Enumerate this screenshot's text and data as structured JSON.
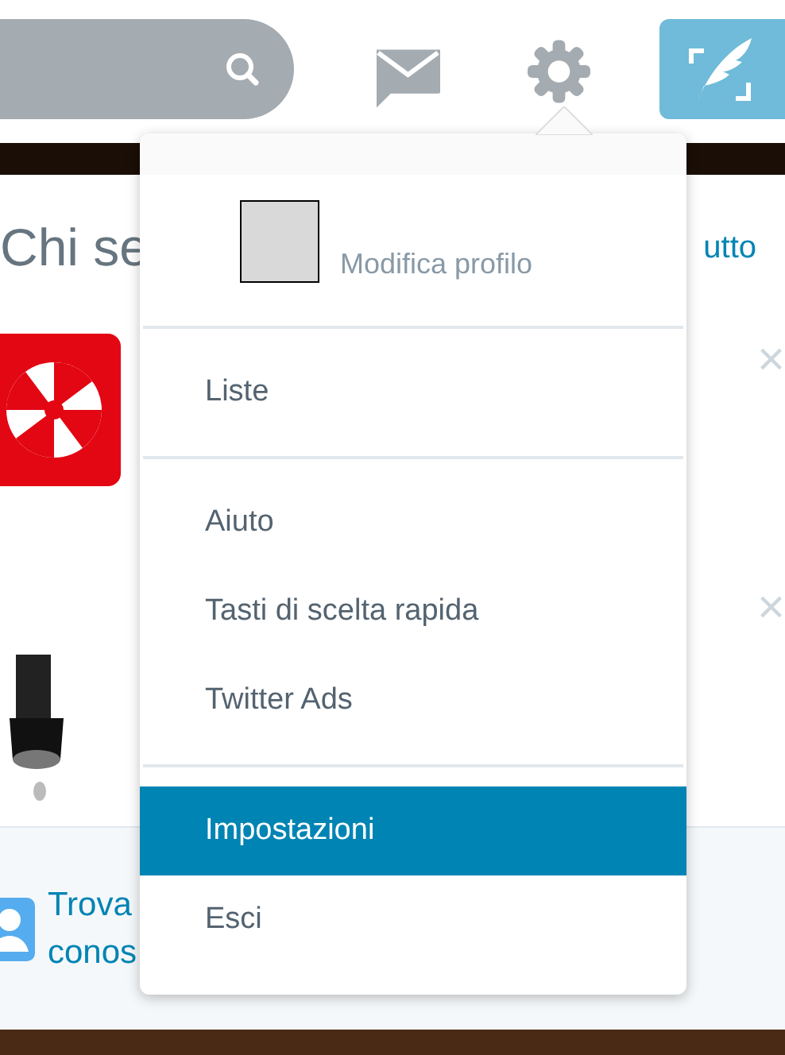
{
  "who_to_follow": {
    "title": "Chi se",
    "link": "utto",
    "suggestions": [
      {
        "kind": "logo",
        "dismiss": "×"
      },
      {
        "dismiss": "×"
      }
    ]
  },
  "find_people": {
    "lines": [
      "Trova",
      "conos"
    ]
  },
  "menu": {
    "profile": {
      "label": "Modifica profilo"
    },
    "groups": [
      [
        {
          "label": "Liste",
          "selected": false
        }
      ],
      [
        {
          "label": "Aiuto",
          "selected": false
        },
        {
          "label": "Tasti di scelta rapida",
          "selected": false
        },
        {
          "label": "Twitter Ads",
          "selected": false
        }
      ],
      [
        {
          "label": "Impostazioni",
          "selected": true
        },
        {
          "label": "Esci",
          "selected": false
        }
      ]
    ]
  }
}
